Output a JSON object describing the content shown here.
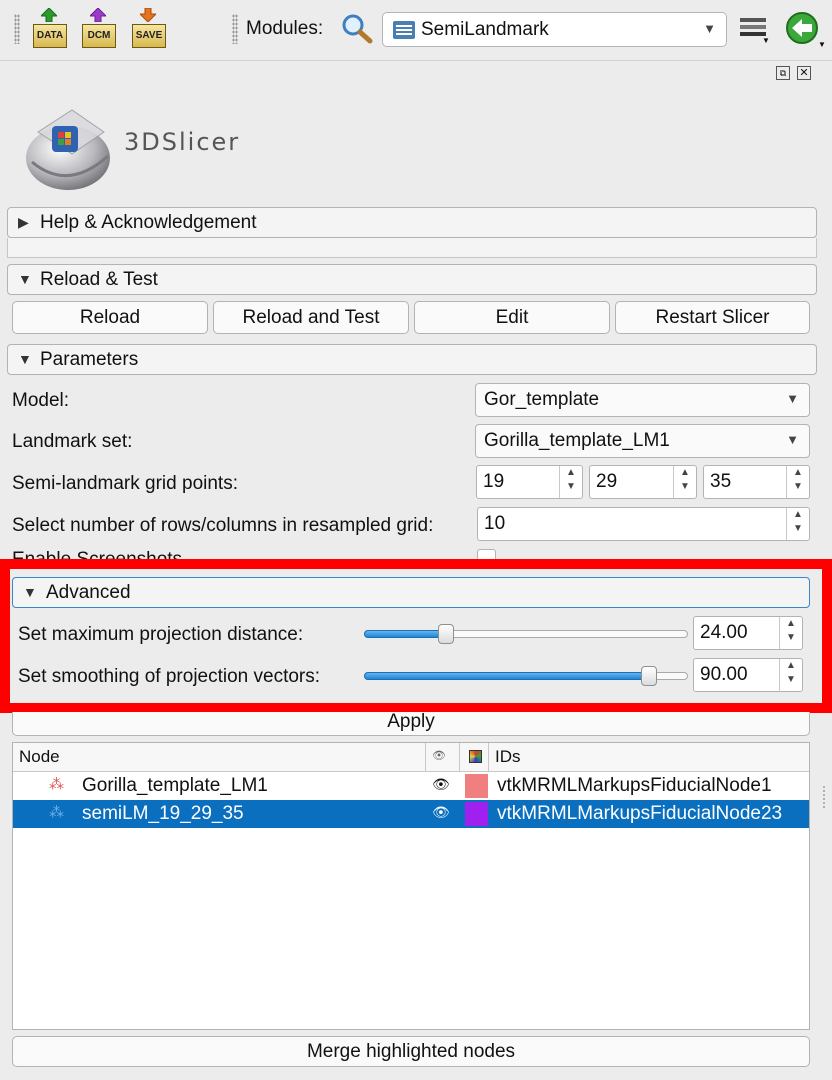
{
  "toolbar": {
    "buttons": [
      {
        "label": "DATA",
        "icon": "data-icon"
      },
      {
        "label": "DCM",
        "icon": "dicom-icon"
      },
      {
        "label": "SAVE",
        "icon": "save-icon"
      }
    ],
    "modules_label": "Modules:",
    "selected_module": "SemiLandmark"
  },
  "logo": {
    "text": "3DSlicer"
  },
  "sections": {
    "help": "Help & Acknowledgement",
    "reload": "Reload & Test",
    "parameters": "Parameters",
    "advanced": "Advanced"
  },
  "reload_buttons": [
    "Reload",
    "Reload and Test",
    "Edit",
    "Restart Slicer"
  ],
  "parameters": {
    "model_label": "Model:",
    "model_value": "Gor_template",
    "landmark_label": "Landmark set:",
    "landmark_value": "Gorilla_template_LM1",
    "grid_label": "Semi-landmark grid points:",
    "grid_values": [
      "19",
      "29",
      "35"
    ],
    "rows_label": "Select number of rows/columns in resampled grid:",
    "rows_value": "10",
    "screenshots_label": "Enable Screenshots"
  },
  "advanced": {
    "max_distance_label": "Set maximum projection distance:",
    "max_distance_value": "24.00",
    "max_distance_fraction": 0.24,
    "smoothing_label": "Set smoothing of projection vectors:",
    "smoothing_value": "90.00",
    "smoothing_fraction": 0.9
  },
  "apply_label": "Apply",
  "tree": {
    "header_node": "Node",
    "header_ids": "IDs",
    "rows": [
      {
        "name": "Gorilla_template_LM1",
        "id": "vtkMRMLMarkupsFiducialNode1",
        "color": "#f08080",
        "selected": false
      },
      {
        "name": "semiLM_19_29_35",
        "id": "vtkMRMLMarkupsFiducialNode23",
        "color": "#a020f0",
        "selected": true
      }
    ]
  },
  "merge_label": "Merge highlighted nodes",
  "colors": {
    "highlight_box": "#ff0000",
    "selection": "#0b6fc0",
    "accent": "#1f86d6"
  }
}
